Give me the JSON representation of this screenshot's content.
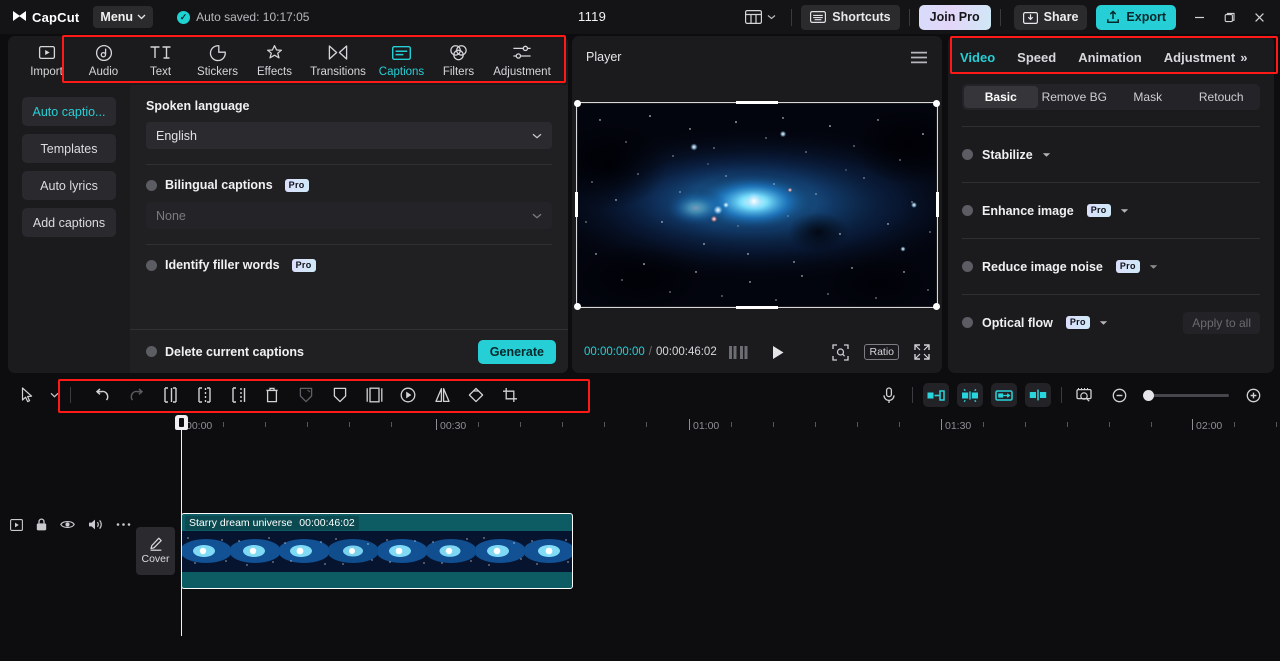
{
  "titlebar": {
    "app_name": "CapCut",
    "menu_label": "Menu",
    "autosave_text": "Auto saved: 10:17:05",
    "project_title": "1119",
    "shortcuts_label": "Shortcuts",
    "join_pro_label": "Join Pro",
    "share_label": "Share",
    "export_label": "Export",
    "accent_cyan": "#26cfd6",
    "annotation_color": "#ff1a18"
  },
  "toolbar": {
    "items": [
      {
        "label": "Import",
        "icon": "import-icon",
        "active": false
      },
      {
        "label": "Audio",
        "icon": "audio-icon",
        "active": false
      },
      {
        "label": "Text",
        "icon": "text-icon",
        "active": false
      },
      {
        "label": "Stickers",
        "icon": "stickers-icon",
        "active": false
      },
      {
        "label": "Effects",
        "icon": "effects-icon",
        "active": false
      },
      {
        "label": "Transitions",
        "icon": "transitions-icon",
        "active": false
      },
      {
        "label": "Captions",
        "icon": "captions-icon",
        "active": true
      },
      {
        "label": "Filters",
        "icon": "filters-icon",
        "active": false
      },
      {
        "label": "Adjustment",
        "icon": "adjustment-icon",
        "active": false
      }
    ]
  },
  "captions_panel": {
    "side_items": [
      {
        "label": "Auto captio...",
        "active": true
      },
      {
        "label": "Templates",
        "active": false
      },
      {
        "label": "Auto lyrics",
        "active": false
      },
      {
        "label": "Add captions",
        "active": false
      }
    ],
    "spoken_language_label": "Spoken language",
    "spoken_language_value": "English",
    "bilingual_label": "Bilingual captions",
    "bilingual_pro": "Pro",
    "bilingual_value": "None",
    "filler_label": "Identify filler words",
    "filler_pro": "Pro",
    "delete_captions_label": "Delete current captions",
    "generate_label": "Generate"
  },
  "player": {
    "title": "Player",
    "current_time": "00:00:00:00",
    "time_separator": "/",
    "total_time": "00:00:46:02"
  },
  "player_controls": {
    "ratio_label": "Ratio"
  },
  "right_panel": {
    "tabs": [
      {
        "label": "Video",
        "active": true
      },
      {
        "label": "Speed",
        "active": false
      },
      {
        "label": "Animation",
        "active": false
      },
      {
        "label": "Adjustment",
        "active": false
      }
    ],
    "tabs_overflow": "»",
    "subtabs": [
      {
        "label": "Basic",
        "active": true
      },
      {
        "label": "Remove BG",
        "active": false
      },
      {
        "label": "Mask",
        "active": false
      },
      {
        "label": "Retouch",
        "active": false
      }
    ],
    "rows": [
      {
        "label": "Stabilize",
        "pro": ""
      },
      {
        "label": "Enhance image",
        "pro": "Pro"
      },
      {
        "label": "Reduce image noise",
        "pro": "Pro"
      },
      {
        "label": "Optical flow",
        "pro": "Pro"
      }
    ],
    "apply_to_all_label": "Apply to all"
  },
  "timeline": {
    "ruler_labels": [
      "00:00",
      "00:30",
      "01:00",
      "01:30",
      "02:00"
    ],
    "clip": {
      "name": "Starry dream universe",
      "duration": "00:00:46:02",
      "thumbnail_count": 8
    },
    "cover_label": "Cover",
    "track_icons": [
      "video-track-icon",
      "lock-icon",
      "eye-icon",
      "speaker-icon",
      "more-icon"
    ],
    "toolbar_icons": [
      "select-cursor-icon",
      "chevron-down-icon",
      "undo-icon",
      "redo-icon",
      "split-icon",
      "split-left-icon",
      "split-right-icon",
      "delete-icon",
      "freeze-icon",
      "mask-icon",
      "mirror-panel-icon",
      "speed-icon",
      "flip-icon",
      "rotate-icon",
      "crop-icon"
    ],
    "right_icons": [
      "microphone-icon",
      "clip-trim-start-icon",
      "auto-cut-icon",
      "clip-link-icon",
      "clip-split-icon",
      "preview-render-icon",
      "zoom-out-icon",
      "zoom-slider",
      "zoom-in-icon"
    ]
  }
}
